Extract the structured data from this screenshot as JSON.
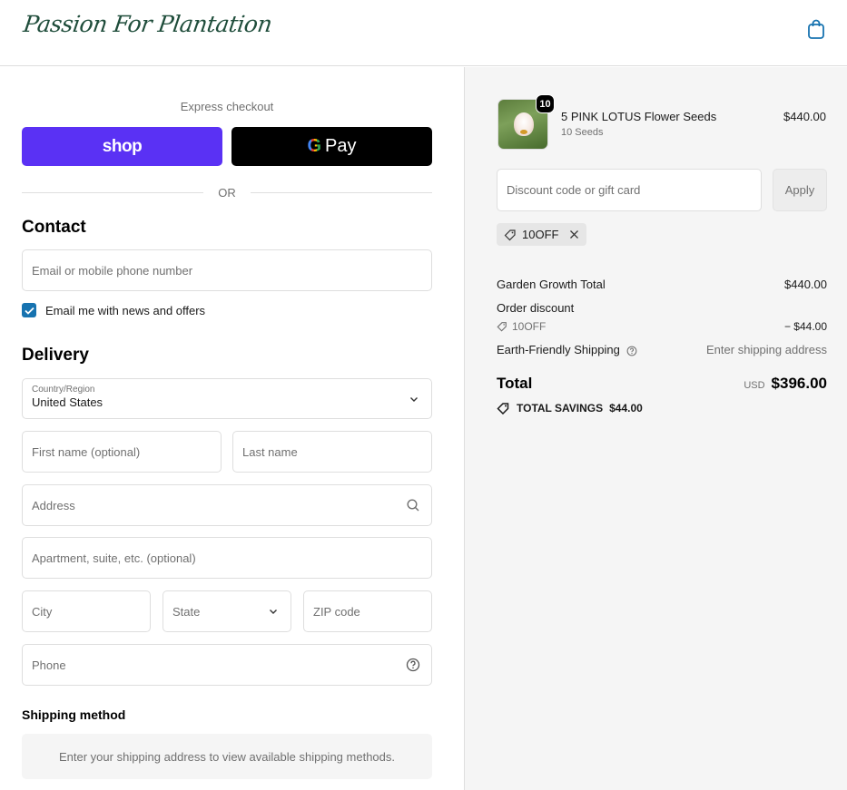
{
  "header": {
    "logo_text": "Passion For Plantation",
    "cart_icon": "shopping-bag-icon"
  },
  "express": {
    "title": "Express checkout",
    "shop_label": "shop",
    "gpay_g": "G",
    "gpay_label": "Pay",
    "or_label": "OR"
  },
  "contact": {
    "title": "Contact",
    "email_placeholder": "Email or mobile phone number",
    "newsletter_label": "Email me with news and offers",
    "newsletter_checked": true
  },
  "delivery": {
    "title": "Delivery",
    "country_label": "Country/Region",
    "country_value": "United States",
    "first_name_placeholder": "First name (optional)",
    "last_name_placeholder": "Last name",
    "address_placeholder": "Address",
    "apartment_placeholder": "Apartment, suite, etc. (optional)",
    "city_placeholder": "City",
    "state_label": "State",
    "zip_placeholder": "ZIP code",
    "phone_placeholder": "Phone"
  },
  "shipping_method": {
    "title": "Shipping method",
    "message": "Enter your shipping address to view available shipping methods."
  },
  "order": {
    "item": {
      "quantity": "10",
      "name": "5 PINK LOTUS Flower Seeds",
      "variant": "10 Seeds",
      "price": "$440.00"
    },
    "discount_placeholder": "Discount code or gift card",
    "apply_label": "Apply",
    "applied_code": "10OFF"
  },
  "summary": {
    "subtotal_label": "Garden Growth Total",
    "subtotal_value": "$440.00",
    "discount_label": "Order discount",
    "discount_code": "10OFF",
    "discount_value": "− $44.00",
    "shipping_label": "Earth-Friendly Shipping",
    "shipping_value": "Enter shipping address",
    "total_label": "Total",
    "total_currency": "USD",
    "total_value": "$396.00",
    "savings_label": "TOTAL SAVINGS",
    "savings_value": "$44.00"
  },
  "colors": {
    "shop_pay": "#5a31f4",
    "gpay": "#000000",
    "checkbox": "#1773b0",
    "logo": "#1f4d3b"
  }
}
